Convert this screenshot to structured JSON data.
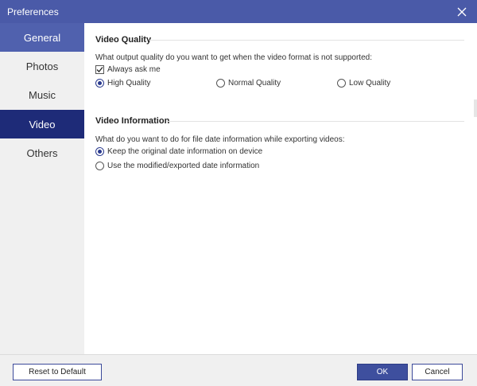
{
  "window": {
    "title": "Preferences"
  },
  "sidebar": {
    "items": [
      {
        "label": "General"
      },
      {
        "label": "Photos"
      },
      {
        "label": "Music"
      },
      {
        "label": "Video"
      },
      {
        "label": "Others"
      }
    ],
    "selected": "Video"
  },
  "video_quality": {
    "title": "Video Quality",
    "question": "What output quality do you want to get when the video format is not supported:",
    "always_ask": {
      "label": "Always ask me",
      "checked": true
    },
    "options": [
      {
        "label": "High Quality",
        "selected": true
      },
      {
        "label": "Normal Quality",
        "selected": false
      },
      {
        "label": "Low Quality",
        "selected": false
      }
    ]
  },
  "video_information": {
    "title": "Video Information",
    "question": "What do you want to do for file date information while exporting videos:",
    "options": [
      {
        "label": "Keep the original date information on device",
        "selected": true
      },
      {
        "label": "Use the modified/exported date information",
        "selected": false
      }
    ]
  },
  "footer": {
    "reset_label": "Reset to Default",
    "ok_label": "OK",
    "cancel_label": "Cancel"
  },
  "colors": {
    "titlebar": "#4a5aa8",
    "general_highlight": "#5061ae",
    "selected_nav": "#1e2b78",
    "ok_button": "#3e4f9e"
  }
}
